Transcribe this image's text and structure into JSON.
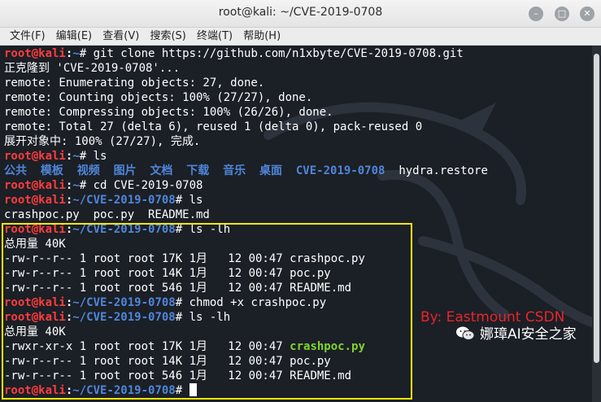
{
  "window": {
    "title": "root@kali: ~/CVE-2019-0708",
    "buttons": {
      "minimize": "–",
      "maximize": "□",
      "close": "✕"
    }
  },
  "menu": [
    "文件(F)",
    "编辑(E)",
    "查看(V)",
    "搜索(S)",
    "终端(T)",
    "帮助(H)"
  ],
  "prompt": {
    "user": "root@kali",
    "colon": ":",
    "home_path": "~",
    "repo_path": "~/CVE-2019-0708",
    "suffix": "# "
  },
  "terminal": {
    "cmd1": "git clone https://github.com/n1xbyte/CVE-2019-0708.git",
    "out1": [
      "正克隆到 'CVE-2019-0708'...",
      "remote: Enumerating objects: 27, done.",
      "remote: Counting objects: 100% (27/27), done.",
      "remote: Compressing objects: 100% (26/26), done.",
      "remote: Total 27 (delta 6), reused 1 (delta 0), pack-reused 0",
      "展开对象中: 100% (27/27), 完成."
    ],
    "cmd2": "ls",
    "ls_dirs": [
      "公共",
      "模板",
      "视频",
      "图片",
      "文档",
      "下载",
      "音乐",
      "桌面",
      "CVE-2019-0708"
    ],
    "ls_file": "hydra.restore",
    "cmd3": "cd CVE-2019-0708",
    "cmd4": "ls",
    "out4": "crashpoc.py  poc.py  README.md",
    "cmd5": "ls -lh",
    "total5": "总用量 40K",
    "listing5": [
      {
        "meta": "-rw-r--r-- 1 root root 17K 1月   12 00:47 ",
        "name": "crashpoc.py"
      },
      {
        "meta": "-rw-r--r-- 1 root root 14K 1月   12 00:47 ",
        "name": "poc.py"
      },
      {
        "meta": "-rw-r--r-- 1 root root 546 1月   12 00:47 ",
        "name": "README.md"
      }
    ],
    "cmd6": "chmod +x crashpoc.py",
    "cmd7": "ls -lh",
    "total7": "总用量 40K",
    "listing7": [
      {
        "meta": "-rwxr-xr-x 1 root root 17K 1月   12 00:47 ",
        "name": "crashpoc.py"
      },
      {
        "meta": "-rw-r--r-- 1 root root 14K 1月   12 00:47 ",
        "name": "poc.py"
      },
      {
        "meta": "-rw-r--r-- 1 root root 546 1月   12 00:47 ",
        "name": "README.md"
      }
    ]
  },
  "watermark": {
    "author": "By:  Eastmount CSDN",
    "account": "娜璋AI安全之家"
  },
  "colors": {
    "prompt_user": "#ff3d3d",
    "prompt_path": "#4f86d9",
    "executable": "#7fd629",
    "highlight_box": "#ffe600",
    "watermark": "#e8262b"
  }
}
